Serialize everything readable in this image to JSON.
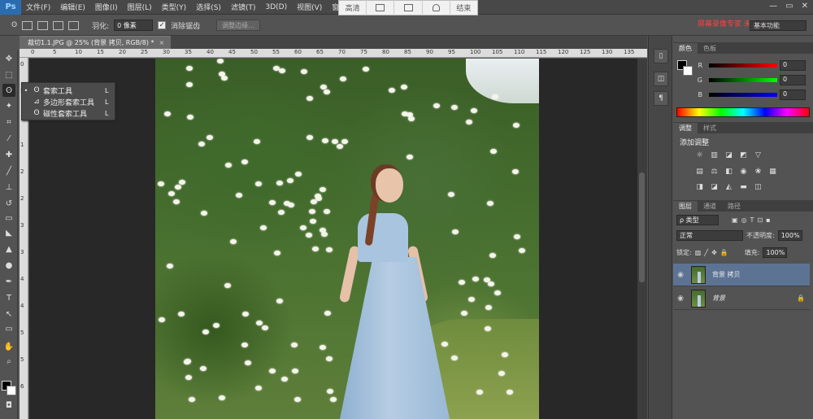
{
  "app": {
    "logo": "Ps"
  },
  "menu": [
    "文件(F)",
    "编辑(E)",
    "图像(I)",
    "图层(L)",
    "类型(Y)",
    "选择(S)",
    "滤镜(T)",
    "3D(D)",
    "视图(V)",
    "窗口"
  ],
  "float_toolbar": {
    "hd_label": "高清",
    "end_label": "结束"
  },
  "window_controls": {
    "minimize": "—",
    "restore": "▭",
    "close": "✕"
  },
  "options": {
    "feather_label": "羽化:",
    "feather_value": "0 像素",
    "antialias_label": "消除锯齿",
    "antialias_check": "✓",
    "refine_button": "调整边缘..."
  },
  "warning_text": "屏幕录像专家 未注册",
  "workspace": "基本功能",
  "document": {
    "tab_title": "裁切1.1.JPG @ 25% (背景 拷贝, RGB/8) *",
    "close": "×",
    "ruler_top": [
      "0",
      "5",
      "10",
      "15",
      "20",
      "25",
      "30",
      "35",
      "40",
      "45",
      "50",
      "55",
      "60",
      "65",
      "70",
      "75",
      "80",
      "85",
      "90",
      "95",
      "100",
      "105",
      "110",
      "115",
      "120",
      "125",
      "130",
      "135"
    ],
    "ruler_left": [
      "0",
      "5",
      "1",
      "1",
      "2",
      "2",
      "3",
      "3",
      "4",
      "4",
      "5",
      "5",
      "6"
    ]
  },
  "tools_flyout": [
    {
      "bullet": "•",
      "icon": "ʘ",
      "name": "套索工具",
      "key": "L"
    },
    {
      "bullet": "",
      "icon": "⊿",
      "name": "多边形套索工具",
      "key": "L"
    },
    {
      "bullet": "",
      "icon": "ʘ",
      "name": "磁性套索工具",
      "key": "L"
    }
  ],
  "tool_glyphs": {
    "move": "✥",
    "marquee": "⬚",
    "lasso": "ʘ",
    "wand": "✦",
    "crop": "⌗",
    "eyedropper": "⁄",
    "heal": "✚",
    "brush": "╱",
    "stamp": "⊥",
    "history": "↺",
    "eraser": "▭",
    "bucket": "◣",
    "blur": "▲",
    "dodge": "●",
    "pen": "✒",
    "type": "T",
    "path-select": "↖",
    "shape": "▭",
    "hand": "✋",
    "zoom": "⌕",
    "quickmask": "◘"
  },
  "color_panel": {
    "tabs": [
      "颜色",
      "色板"
    ],
    "channels": [
      {
        "label": "R",
        "value": "0",
        "color": "#ff0000"
      },
      {
        "label": "G",
        "value": "0",
        "color": "#00ff00"
      },
      {
        "label": "B",
        "value": "0",
        "color": "#0000ff"
      }
    ]
  },
  "adjust_panel": {
    "tabs": [
      "调整",
      "样式"
    ],
    "title": "添加调整",
    "row1": [
      "☼",
      "▥",
      "◪",
      "◩",
      "▽"
    ],
    "row2": [
      "▤",
      "⚖",
      "◧",
      "◉",
      "❀",
      "▦"
    ],
    "row3": [
      "◨",
      "◪",
      "◭",
      "▬",
      "◫"
    ]
  },
  "layers_panel": {
    "tabs": [
      "图层",
      "通道",
      "路径"
    ],
    "filter_type": "ρ 类型",
    "filter_icons": [
      "▣",
      "◎",
      "T",
      "⊡",
      "▪"
    ],
    "blend_mode": "正常",
    "opacity_label": "不透明度:",
    "opacity_value": "100%",
    "lock_label": "锁定:",
    "lock_icons": [
      "▨",
      "╱",
      "✥",
      "🔒"
    ],
    "fill_label": "填充:",
    "fill_value": "100%",
    "layers": [
      {
        "name": "背景 拷贝",
        "selected": true,
        "lock": ""
      },
      {
        "name": "背景",
        "selected": false,
        "lock": "🔒"
      }
    ],
    "eye": "◉"
  },
  "accent": "#5c7394"
}
